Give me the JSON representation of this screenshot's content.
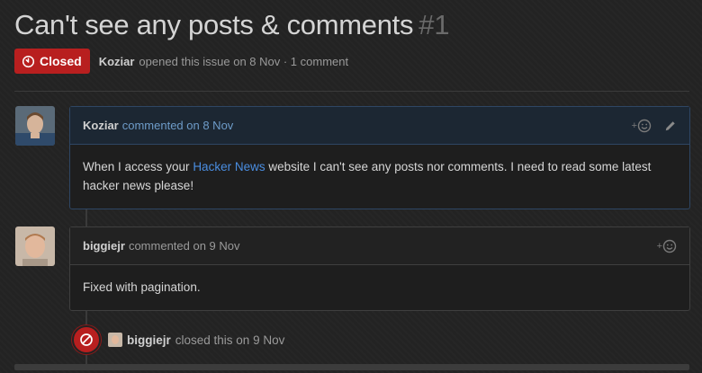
{
  "issue": {
    "title": "Can't see any posts & comments",
    "number": "#1",
    "state": "Closed",
    "author": "Koziar",
    "meta_text": "opened this issue on 8 Nov · 1 comment"
  },
  "comments": [
    {
      "author": "Koziar",
      "action": "commented on 8 Nov",
      "body_prefix": "When I access your ",
      "body_link": "Hacker News",
      "body_suffix": " website I can't see any posts nor comments. I need to read some latest hacker news please!",
      "reaction_icon": "smiley-plus-icon",
      "edit_icon": "pencil-icon"
    },
    {
      "author": "biggiejr",
      "action": "commented on 9 Nov",
      "body": "Fixed with pagination.",
      "reaction_icon": "smiley-plus-icon"
    }
  ],
  "event": {
    "author": "biggiejr",
    "action": "closed this on 9 Nov",
    "icon": "closed-circle-icon"
  },
  "colors": {
    "closed_red": "#b81f1f",
    "link_blue": "#4a8de0",
    "background": "#232323"
  }
}
